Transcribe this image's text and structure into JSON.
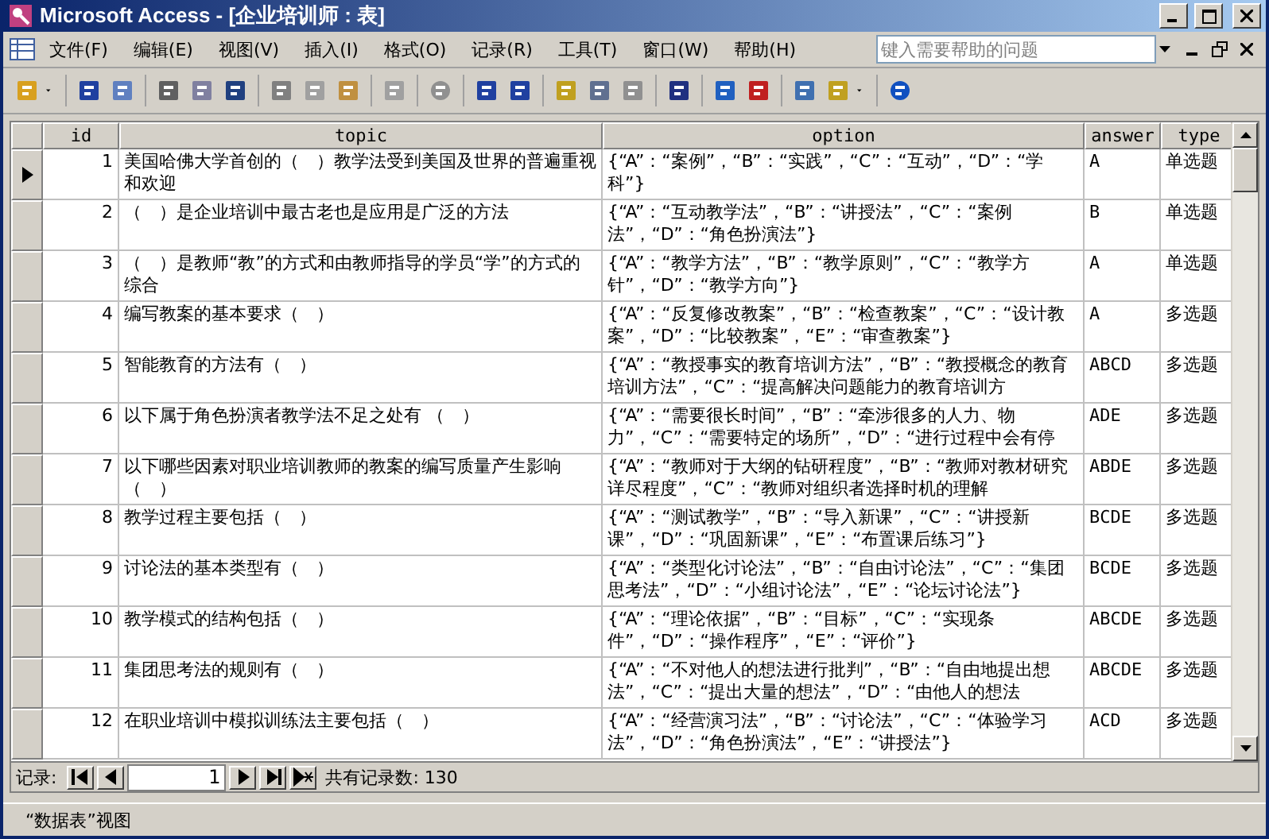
{
  "window": {
    "title": "Microsoft Access - [企业培训师 : 表]"
  },
  "menu": [
    "文件(F)",
    "编辑(E)",
    "视图(V)",
    "插入(I)",
    "格式(O)",
    "记录(R)",
    "工具(T)",
    "窗口(W)",
    "帮助(H)"
  ],
  "help_box": {
    "placeholder": "键入需要帮助的问题"
  },
  "table": {
    "columns": [
      "id",
      "topic",
      "option",
      "answer",
      "type"
    ],
    "rows": [
      {
        "current": true,
        "cells": [
          "1",
          "美国哈佛大学首创的（　）教学法受到美国及世界的普遍重视和欢迎",
          "{“A”：“案例”，“B”：“实践”，“C”：“互动”，“D”：“学科”}",
          "A",
          "单选题"
        ]
      },
      {
        "current": false,
        "cells": [
          "2",
          "（　）是企业培训中最古老也是应用是广泛的方法",
          "{“A”：“互动教学法”，“B”：“讲授法”，“C”：“案例法”，“D”：“角色扮演法”}",
          "B",
          "单选题"
        ]
      },
      {
        "current": false,
        "cells": [
          "3",
          "（　）是教师“教”的方式和由教师指导的学员“学”的方式的综合",
          "{“A”：“教学方法”，“B”：“教学原则”，“C”：“教学方针”，“D”：“教学方向”}",
          "A",
          "单选题"
        ]
      },
      {
        "current": false,
        "cells": [
          "4",
          "编写教案的基本要求（　）",
          "{“A”：“反复修改教案”，“B”：“检查教案”，“C”：“设计教案”，“D”：“比较教案”，“E”：“审查教案”}",
          "A",
          "多选题"
        ]
      },
      {
        "current": false,
        "cells": [
          "5",
          "智能教育的方法有（　）",
          "{“A”：“教授事实的教育培训方法”，“B”：“教授概念的教育培训方法”，“C”：“提高解决问题能力的教育培训方",
          "ABCD",
          "多选题"
        ]
      },
      {
        "current": false,
        "cells": [
          "6",
          "以下属于角色扮演者教学法不足之处有 （　）",
          "{“A”：“需要很长时间”，“B”：“牵涉很多的人力、物力”，“C”：“需要特定的场所”，“D”：“进行过程中会有停",
          "ADE",
          "多选题"
        ]
      },
      {
        "current": false,
        "cells": [
          "7",
          "以下哪些因素对职业培训教师的教案的编写质量产生影响（　）",
          "{“A”：“教师对于大纲的钻研程度”，“B”：“教师对教材研究详尽程度”，“C”：“教师对组织者选择时机的理解",
          "ABDE",
          "多选题"
        ]
      },
      {
        "current": false,
        "cells": [
          "8",
          "教学过程主要包括（　）",
          "{“A”：“测试教学”，“B”：“导入新课”，“C”：“讲授新课”，“D”：“巩固新课”，“E”：“布置课后练习”}",
          "BCDE",
          "多选题"
        ]
      },
      {
        "current": false,
        "cells": [
          "9",
          "讨论法的基本类型有（　）",
          "{“A”：“类型化讨论法”，“B”：“自由讨论法”，“C”：“集团思考法”，“D”：“小组讨论法”，“E”：“论坛讨论法”}",
          "BCDE",
          "多选题"
        ]
      },
      {
        "current": false,
        "cells": [
          "10",
          "教学模式的结构包括（　）",
          "{“A”：“理论依据”，“B”：“目标”，“C”：“实现条件”，“D”：“操作程序”，“E”：“评价”}",
          "ABCDE",
          "多选题"
        ]
      },
      {
        "current": false,
        "cells": [
          "11",
          "集团思考法的规则有（　）",
          "{“A”：“不对他人的想法进行批判”，“B”：“自由地提出想法”，“C”：“提出大量的想法”，“D”：“由他人的想法",
          "ABCDE",
          "多选题"
        ]
      },
      {
        "current": false,
        "cells": [
          "12",
          "在职业培训中模拟训练法主要包括（　）",
          "{“A”：“经营演习法”，“B”：“讨论法”，“C”：“体验学习法”，“D”：“角色扮演法”，“E”：“讲授法”}",
          "ACD",
          "多选题"
        ]
      }
    ]
  },
  "record_nav": {
    "label": "记录:",
    "current": "1",
    "total": "共有记录数: 130"
  },
  "status_bar": {
    "view": "“数据表”视图"
  }
}
